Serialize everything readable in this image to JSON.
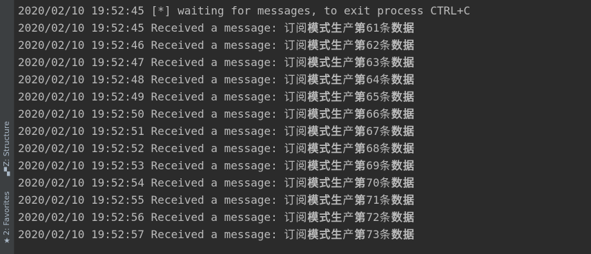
{
  "sidebar": {
    "structure_label": "Z: Structure",
    "structure_icon": "structure-icon",
    "favorites_label": "2: Favorites",
    "favorites_icon": "star-icon"
  },
  "console": {
    "header": {
      "timestamp": "2020/02/10 19:52:45",
      "text": "[*] waiting for messages, to exit process CTRL+C"
    },
    "message_prefix": "Received a message:",
    "msg_a": "订阅",
    "msg_b": "模式生",
    "msg_c": "产",
    "msg_d": "第",
    "msg_e": "条",
    "msg_f": "数据",
    "rows": [
      {
        "timestamp": "2020/02/10 19:52:45",
        "num": "61"
      },
      {
        "timestamp": "2020/02/10 19:52:46",
        "num": "62"
      },
      {
        "timestamp": "2020/02/10 19:52:47",
        "num": "63"
      },
      {
        "timestamp": "2020/02/10 19:52:48",
        "num": "64"
      },
      {
        "timestamp": "2020/02/10 19:52:49",
        "num": "65"
      },
      {
        "timestamp": "2020/02/10 19:52:50",
        "num": "66"
      },
      {
        "timestamp": "2020/02/10 19:52:51",
        "num": "67"
      },
      {
        "timestamp": "2020/02/10 19:52:52",
        "num": "68"
      },
      {
        "timestamp": "2020/02/10 19:52:53",
        "num": "69"
      },
      {
        "timestamp": "2020/02/10 19:52:54",
        "num": "70"
      },
      {
        "timestamp": "2020/02/10 19:52:55",
        "num": "71"
      },
      {
        "timestamp": "2020/02/10 19:52:56",
        "num": "72"
      },
      {
        "timestamp": "2020/02/10 19:52:57",
        "num": "73"
      }
    ]
  },
  "colors": {
    "background": "#2b2b2b",
    "text": "#bbbbbb",
    "sidebar_bg": "#3c3f41"
  }
}
